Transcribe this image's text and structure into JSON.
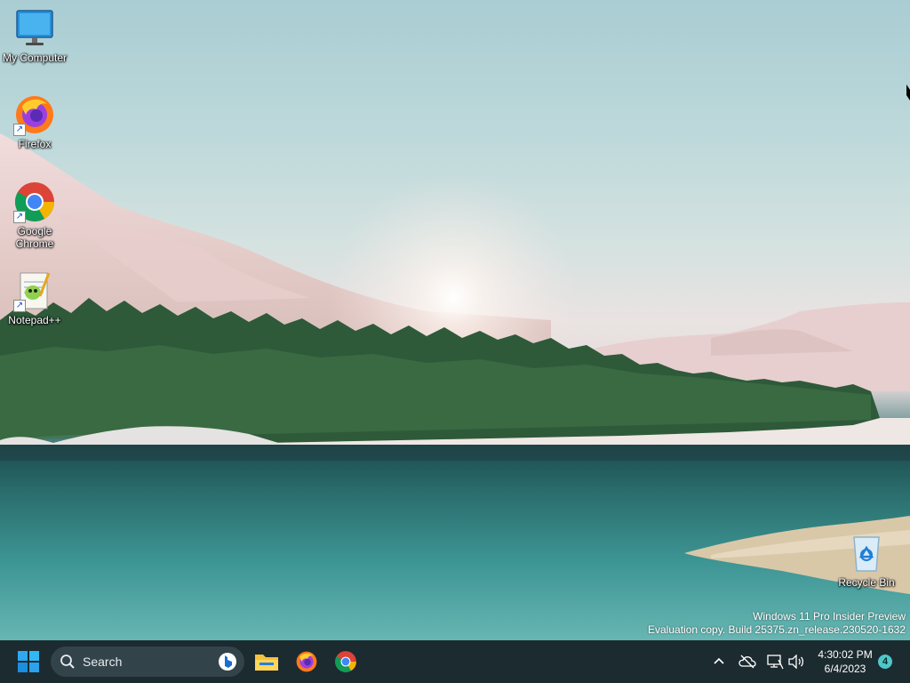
{
  "desktop": {
    "icons": [
      {
        "label": "My Computer",
        "icon": "monitor-icon"
      },
      {
        "label": "Firefox",
        "icon": "firefox-icon"
      },
      {
        "label": "Google\nChrome",
        "icon": "chrome-icon"
      },
      {
        "label": "Notepad++",
        "icon": "notepadpp-icon"
      },
      {
        "label": "Recycle Bin",
        "icon": "recycle-bin-icon"
      }
    ],
    "watermark": {
      "line1": "Windows 11 Pro Insider Preview",
      "line2": "Evaluation copy. Build 25375.zn_release.230520-1632"
    }
  },
  "taskbar": {
    "start_icon": "windows-start-icon",
    "search": {
      "placeholder": "Search",
      "bing_icon": "bing-icon"
    },
    "pinned": [
      "file-explorer-icon",
      "firefox-icon",
      "chrome-icon"
    ],
    "tray": {
      "icons": [
        "chevron-up-icon",
        "cloud-offline-icon",
        "network-icon",
        "volume-icon"
      ],
      "time": "4:30:02 PM",
      "date": "6/4/2023",
      "notification_count": "4"
    }
  },
  "colors": {
    "taskbar_bg": "#1c2b30",
    "search_bg": "#33434a",
    "accent": "#0078d4",
    "badge": "#4ec7c9"
  }
}
